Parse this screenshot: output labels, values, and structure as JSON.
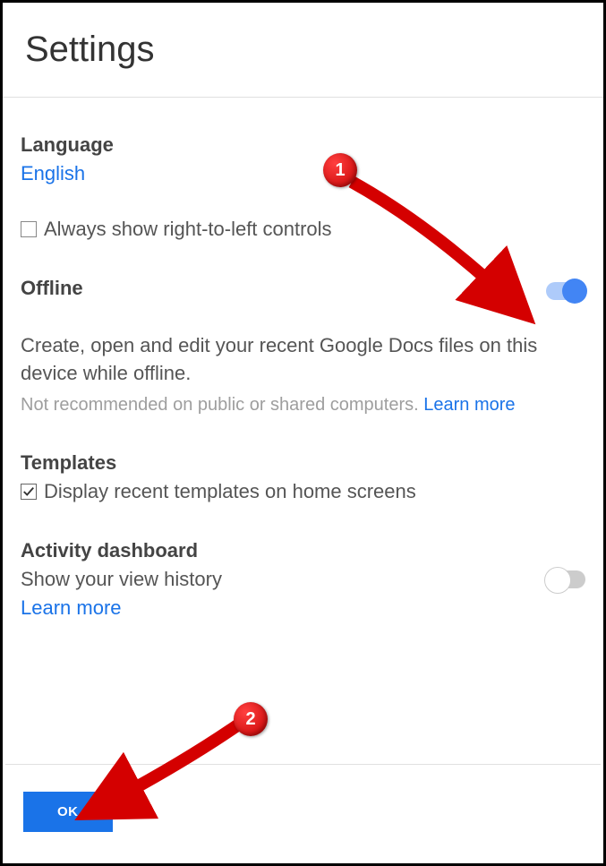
{
  "header": {
    "title": "Settings"
  },
  "language": {
    "title": "Language",
    "value": "English",
    "rtlLabel": "Always show right-to-left controls"
  },
  "offline": {
    "title": "Offline",
    "description": "Create, open and edit your recent Google Docs files on this device while offline.",
    "hint": "Not recommended on public or shared computers. ",
    "learnMore": "Learn more"
  },
  "templates": {
    "title": "Templates",
    "label": "Display recent templates on home screens"
  },
  "activity": {
    "title": "Activity dashboard",
    "subtitle": "Show your view history",
    "learnMore": "Learn more"
  },
  "footer": {
    "ok": "OK"
  },
  "annotations": {
    "c1": "1",
    "c2": "2"
  }
}
